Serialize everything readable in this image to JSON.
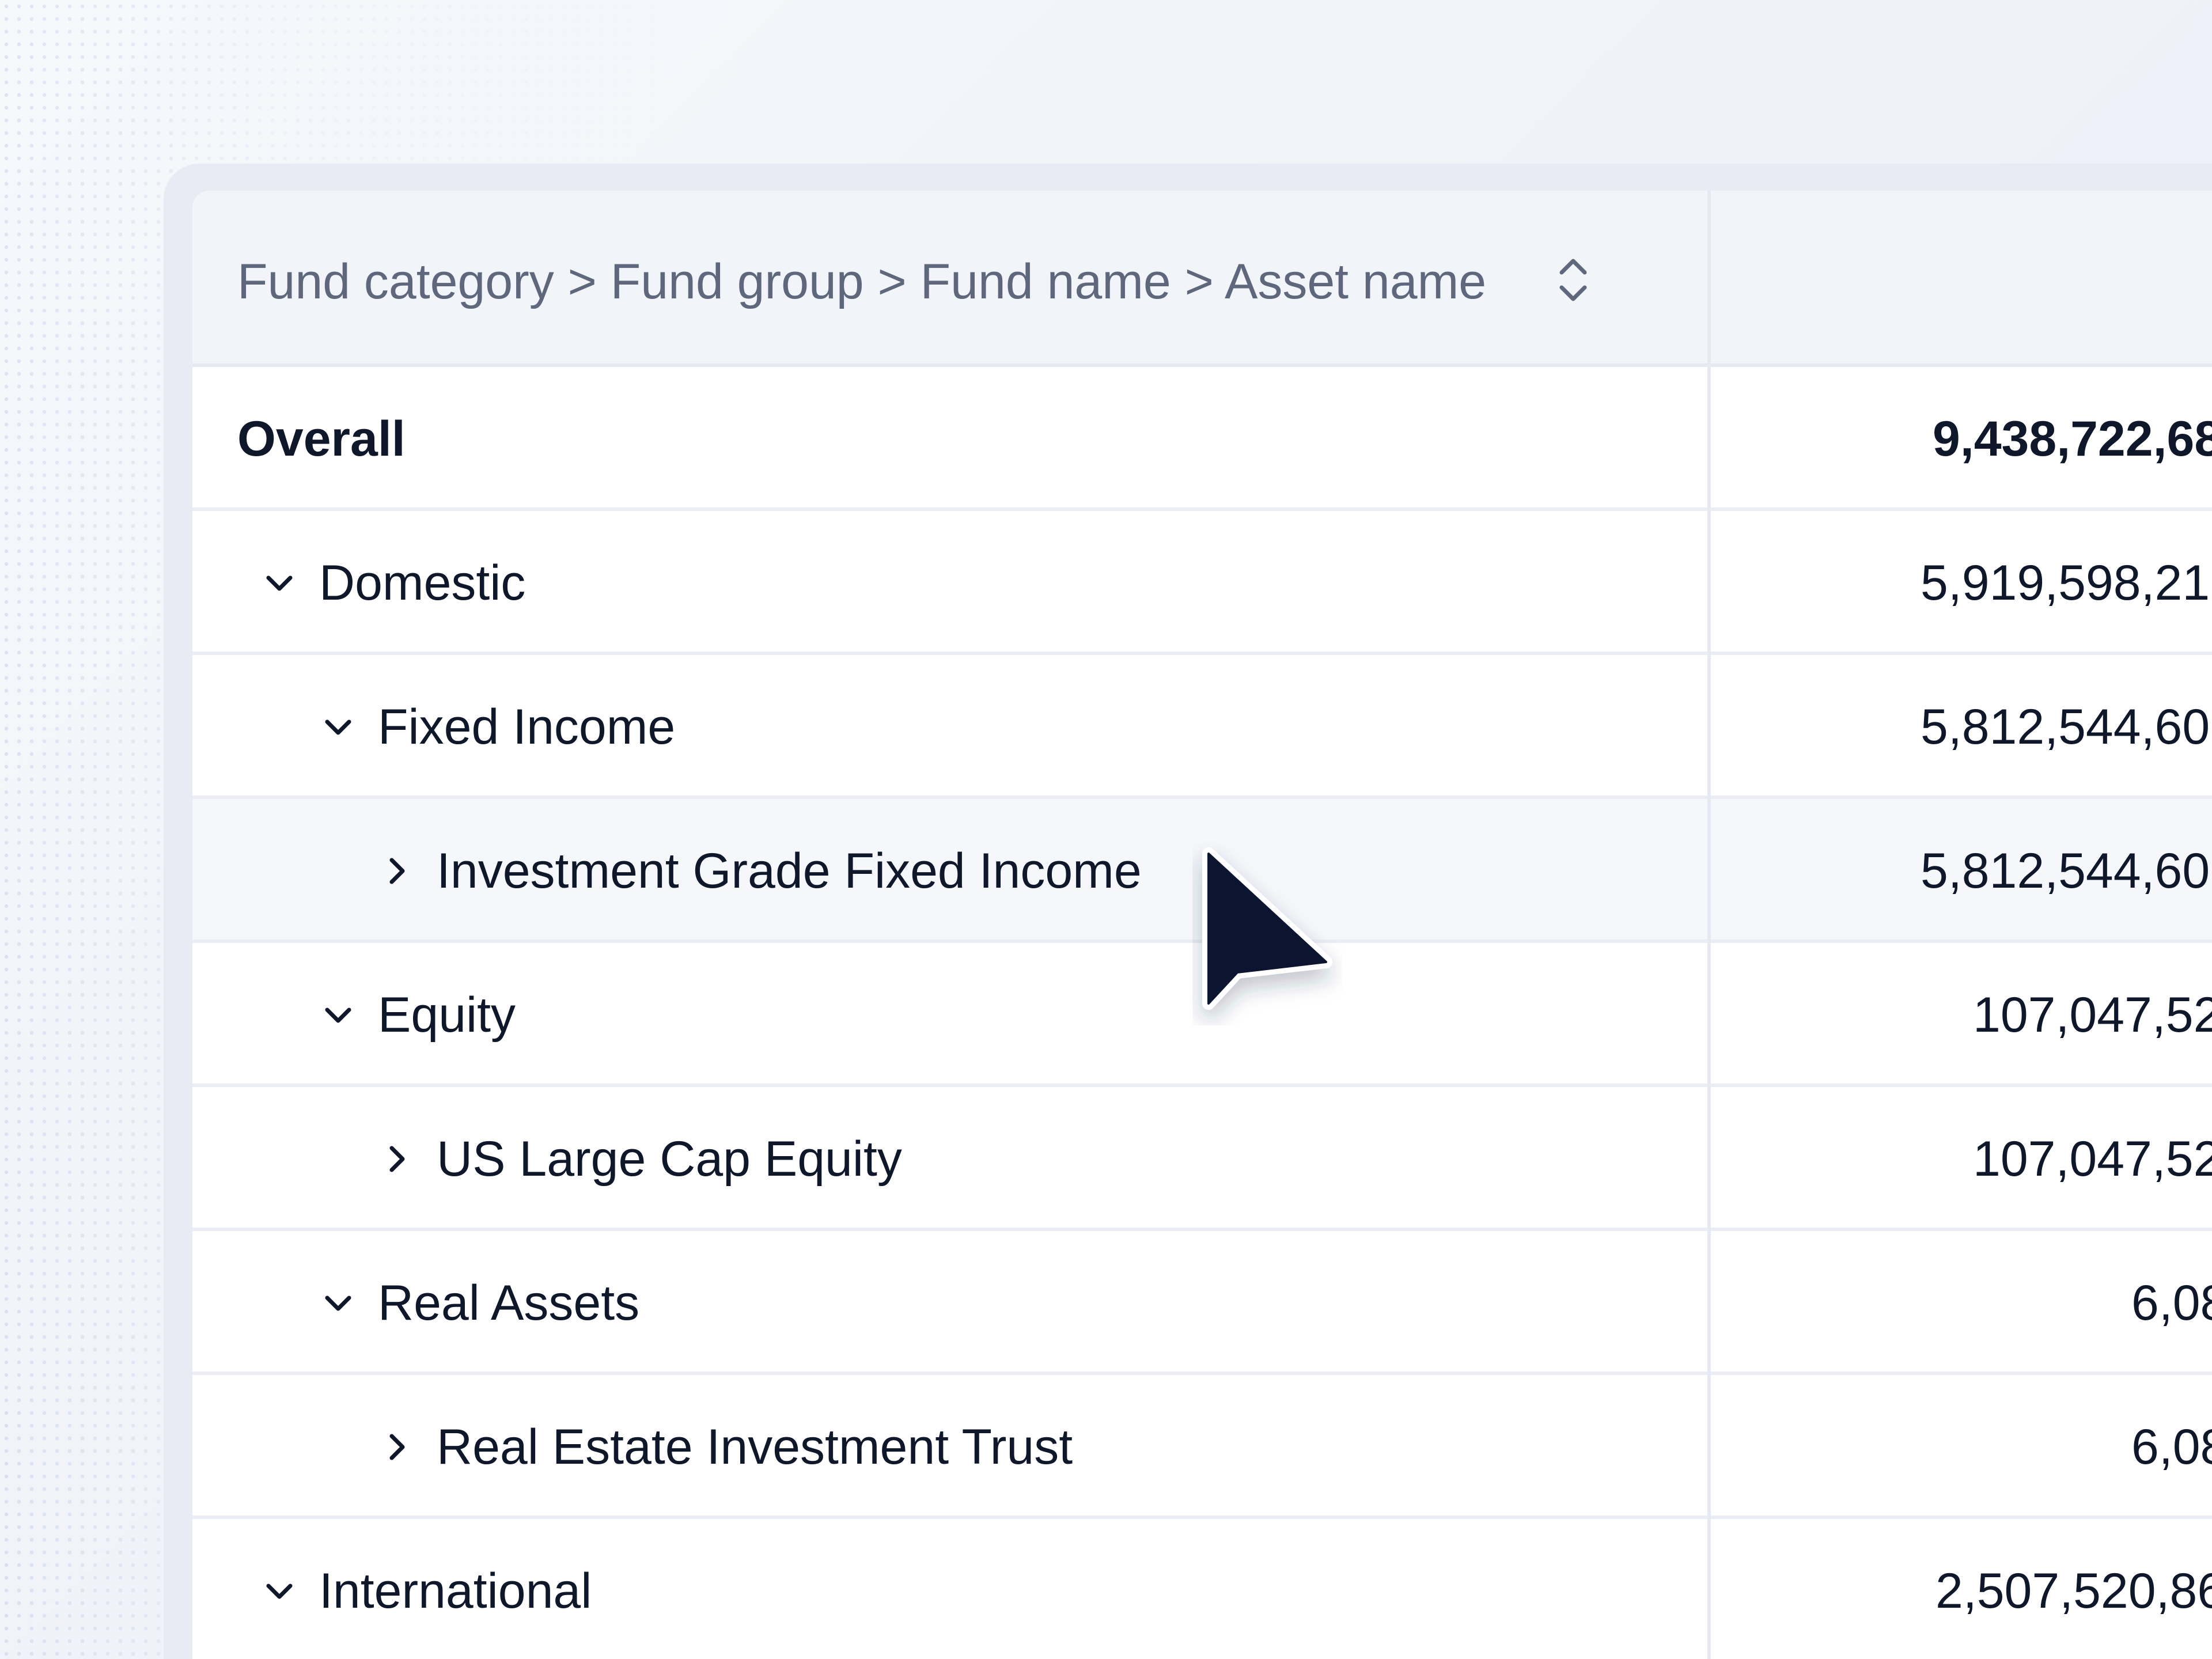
{
  "header": {
    "title": "Fund category > Fund group > Fund name > Asset name",
    "sort_icon": "sort-updown-icon"
  },
  "rows": [
    {
      "label": "Overall",
      "value": "9,438,722,68",
      "level": 0,
      "chevron": "none",
      "bold": true
    },
    {
      "label": "Domestic",
      "value": "5,919,598,21",
      "level": 1,
      "chevron": "chevron-down-icon",
      "bold": false
    },
    {
      "label": "Fixed Income",
      "value": "5,812,544,60",
      "level": 2,
      "chevron": "chevron-down-icon",
      "bold": false
    },
    {
      "label": "Investment Grade Fixed Income",
      "value": "5,812,544,60",
      "level": 3,
      "chevron": "chevron-right-icon",
      "bold": false,
      "hovered": true
    },
    {
      "label": "Equity",
      "value": "107,047,52",
      "level": 2,
      "chevron": "chevron-down-icon",
      "bold": false
    },
    {
      "label": "US Large Cap Equity",
      "value": "107,047,52",
      "level": 3,
      "chevron": "chevron-right-icon",
      "bold": false
    },
    {
      "label": "Real Assets",
      "value": "6,08",
      "level": 2,
      "chevron": "chevron-down-icon",
      "bold": false
    },
    {
      "label": "Real Estate Investment Trust",
      "value": "6,08",
      "level": 3,
      "chevron": "chevron-right-icon",
      "bold": false
    },
    {
      "label": "International",
      "value": "2,507,520,86",
      "level": 1,
      "chevron": "chevron-down-icon",
      "bold": false
    }
  ],
  "colors": {
    "text": "#0f172a",
    "header_text": "#5e677c",
    "header_bg": "#f1f4f9",
    "hover_bg": "#f5f7fb",
    "cursor": "#0b1530"
  }
}
